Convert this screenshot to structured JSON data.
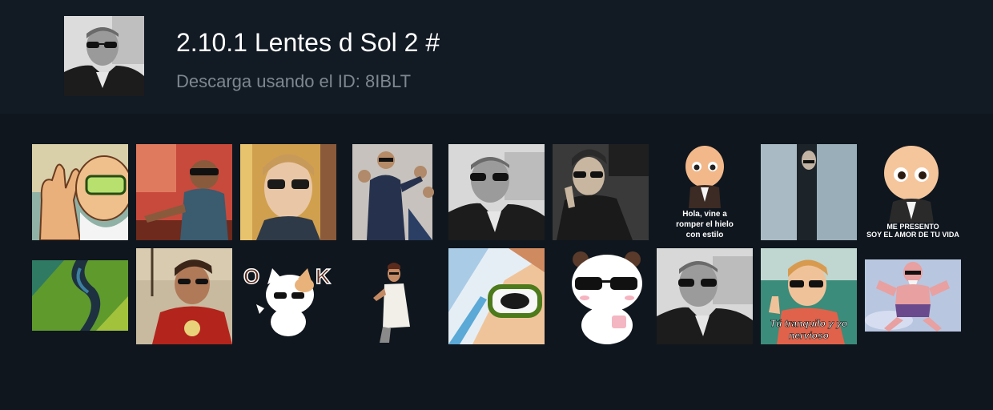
{
  "pack": {
    "title": "2.10.1 Lentes d Sol 2 #",
    "subtitle": "Descarga usando el ID: 8IBLT"
  },
  "stickers": [
    {
      "name": "roshi-peace-sign",
      "caption": ""
    },
    {
      "name": "kid-sunglasses",
      "caption": ""
    },
    {
      "name": "woman-sunglasses",
      "caption": ""
    },
    {
      "name": "man-suit-crowd",
      "caption": ""
    },
    {
      "name": "man-sunglasses-bw",
      "caption": ""
    },
    {
      "name": "man-leather-jacket",
      "caption": ""
    },
    {
      "name": "baby-boss-hola",
      "caption": "Hola, vine a romper el hielo con estilo"
    },
    {
      "name": "door-peek",
      "caption": ""
    },
    {
      "name": "baby-boss-presento",
      "caption": "ME PRESENTO SOY EL AMOR DE TU VIDA"
    },
    {
      "name": "green-swirl",
      "caption": ""
    },
    {
      "name": "ironman-sunglasses",
      "caption": ""
    },
    {
      "name": "cat-ok",
      "caption": "O K"
    },
    {
      "name": "dancing-man",
      "caption": ""
    },
    {
      "name": "anime-goggles",
      "caption": ""
    },
    {
      "name": "bear-sunglasses",
      "caption": ""
    },
    {
      "name": "man-sunglasses-bw-2",
      "caption": ""
    },
    {
      "name": "kid-thumbs-up",
      "caption": "Tú tranquilo y yo nervioso"
    },
    {
      "name": "roshi-pose",
      "caption": ""
    }
  ]
}
